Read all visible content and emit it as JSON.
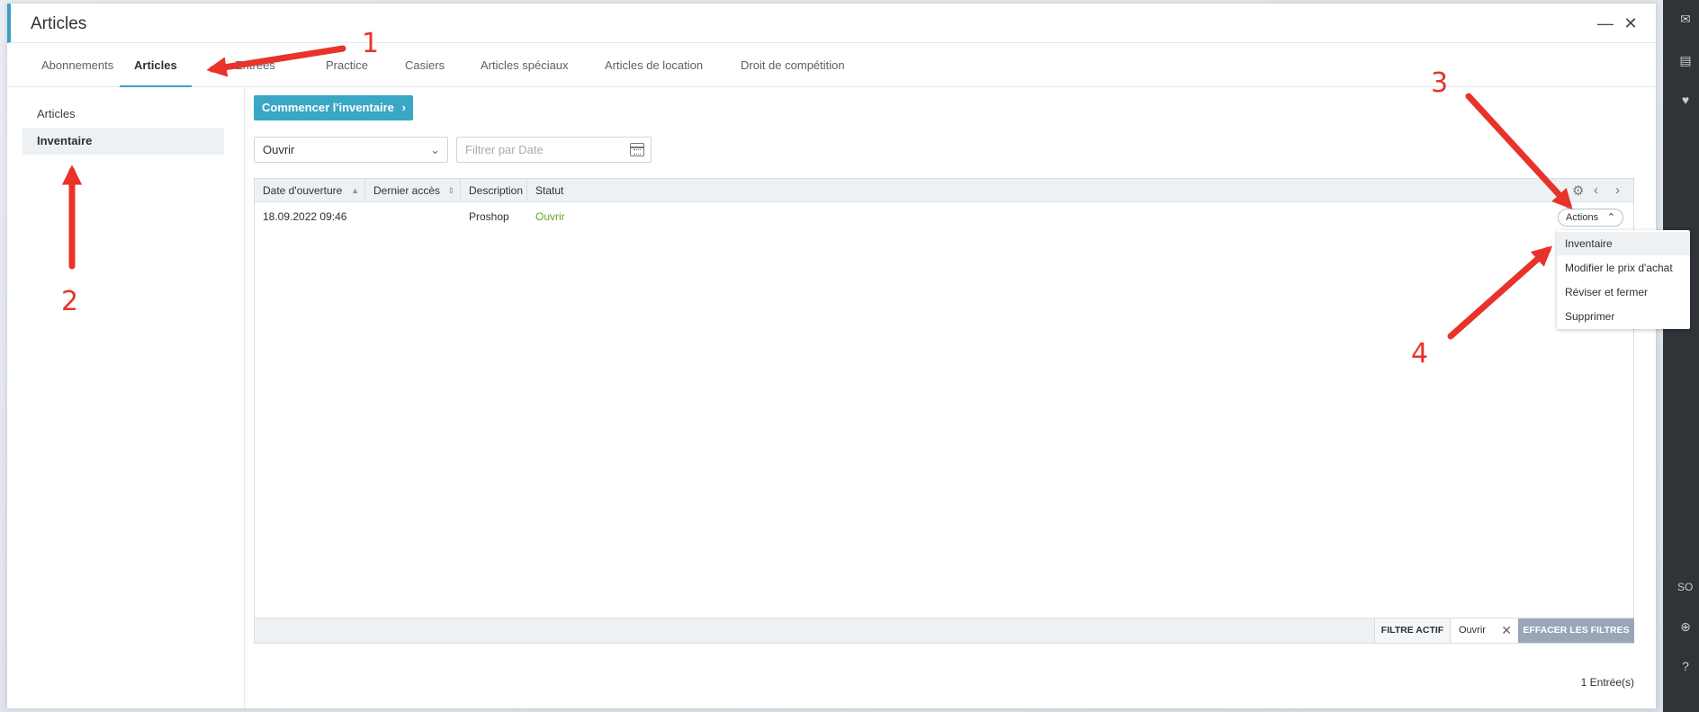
{
  "window": {
    "title": "Articles",
    "minimize_glyph": "—",
    "close_glyph": "✕"
  },
  "tabs": [
    {
      "label": "Abonnements"
    },
    {
      "label": "Articles"
    },
    {
      "label": "Entrées"
    },
    {
      "label": "Practice"
    },
    {
      "label": "Casiers"
    },
    {
      "label": "Articles spéciaux"
    },
    {
      "label": "Articles de location"
    },
    {
      "label": "Droit de compétition"
    }
  ],
  "sidebar": {
    "items": [
      {
        "label": "Articles"
      },
      {
        "label": "Inventaire"
      }
    ]
  },
  "toolbar": {
    "start_label": "Commencer l'inventaire",
    "status_select_value": "Ouvrir",
    "date_placeholder": "Filtrer par Date"
  },
  "grid": {
    "columns": [
      "Date d'ouverture",
      "Dernier accès",
      "Description",
      "Statut"
    ],
    "rows": [
      {
        "date": "18.09.2022 09:46",
        "last_access": "",
        "description": "Proshop",
        "status": "Ouvrir"
      }
    ],
    "actions_label": "Actions",
    "footer": {
      "active_filter_label": "FILTRE ACTIF",
      "filter_chip": "Ouvrir",
      "clear_label": "EFFACER LES FILTRES"
    },
    "entries": "1 Entrée(s)"
  },
  "actions_menu": {
    "items": [
      {
        "label": "Inventaire"
      },
      {
        "label": "Modifier le prix d'achat"
      },
      {
        "label": "Réviser et fermer"
      },
      {
        "label": "Supprimer"
      }
    ]
  },
  "annotations": {
    "color": "#e8332a",
    "labels": [
      "1",
      "2",
      "3",
      "4"
    ]
  },
  "right_rail": {
    "text": "SO"
  },
  "colors": {
    "accent": "#3aa0c8",
    "primary_button": "#3aa7c4",
    "status_open": "#63a822",
    "clear_button": "#9aa6b8"
  }
}
